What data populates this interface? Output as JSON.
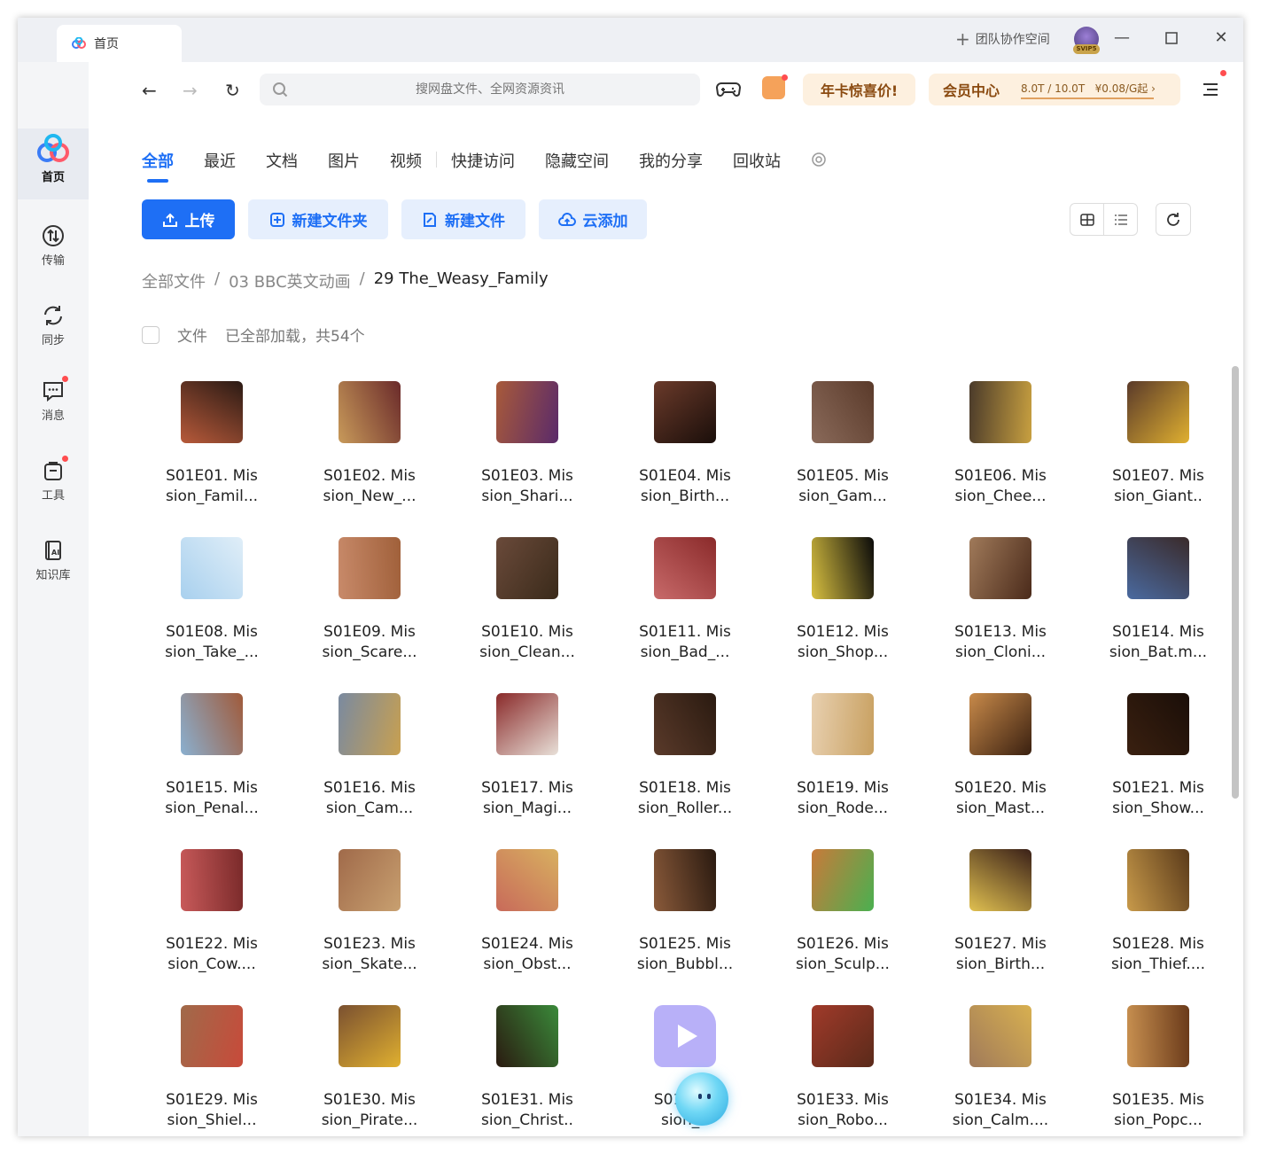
{
  "titlebar": {
    "tab_label": "首页",
    "team_label": "团队协作空间",
    "avatar_badge": "SVIP5"
  },
  "sidebar": {
    "items": [
      {
        "label": "首页",
        "icon": "baidu-netdisk-logo-icon"
      },
      {
        "label": "传输",
        "icon": "transfer-icon"
      },
      {
        "label": "同步",
        "icon": "sync-icon"
      },
      {
        "label": "消息",
        "icon": "message-icon"
      },
      {
        "label": "工具",
        "icon": "tools-icon"
      },
      {
        "label": "知识库",
        "icon": "knowledge-base-icon"
      }
    ]
  },
  "toolbar": {
    "search_placeholder": "搜网盘文件、全网资源资讯",
    "promo_label": "年卡惊喜价!",
    "vip_label": "会员中心",
    "storage_text": "8.0T / 10.0T",
    "price_text": "¥0.08/G起"
  },
  "categories": [
    "全部",
    "最近",
    "文档",
    "图片",
    "视频",
    "快捷访问",
    "隐藏空间",
    "我的分享",
    "回收站"
  ],
  "actions": {
    "upload": "上传",
    "new_folder": "新建文件夹",
    "new_file": "新建文件",
    "cloud_add": "云添加"
  },
  "breadcrumb": [
    "全部文件",
    "03 BBC英文动画",
    "29 The_Weasy_Family"
  ],
  "list_header": {
    "type_label": "文件",
    "status": "已全部加载，共54个"
  },
  "files": [
    {
      "line1": "S01E01. Mis",
      "line2": "sion_Famil...",
      "c1": "#b85a3a",
      "c2": "#2a1a14"
    },
    {
      "line1": "S01E02. Mis",
      "line2": "sion_New_...",
      "c1": "#c89a5a",
      "c2": "#6a2a2a"
    },
    {
      "line1": "S01E03. Mis",
      "line2": "sion_Shari...",
      "c1": "#a85a3a",
      "c2": "#5a2a6a"
    },
    {
      "line1": "S01E04. Mis",
      "line2": "sion_Birth...",
      "c1": "#6a3a2a",
      "c2": "#1a0e0a"
    },
    {
      "line1": "S01E05. Mis",
      "line2": "sion_Gam...",
      "c1": "#8a6a5a",
      "c2": "#5a3a2a"
    },
    {
      "line1": "S01E06. Mis",
      "line2": "sion_Chee...",
      "c1": "#4a3a2a",
      "c2": "#c8a040"
    },
    {
      "line1": "S01E07. Mis",
      "line2": "sion_Giant..",
      "c1": "#5a3a2a",
      "c2": "#e0b030"
    },
    {
      "line1": "S01E08. Mis",
      "line2": "sion_Take_...",
      "c1": "#a8d0ee",
      "c2": "#e0eef8"
    },
    {
      "line1": "S01E09. Mis",
      "line2": "sion_Scare...",
      "c1": "#c88a6a",
      "c2": "#a0603a"
    },
    {
      "line1": "S01E10. Mis",
      "line2": "sion_Clean...",
      "c1": "#6a4a3a",
      "c2": "#3a2a1a"
    },
    {
      "line1": "S01E11. Mis",
      "line2": "sion_Bad_...",
      "c1": "#c86a6a",
      "c2": "#8a2a2a"
    },
    {
      "line1": "S01E12. Mis",
      "line2": "sion_Shop...",
      "c1": "#d8c040",
      "c2": "#0a0a0a"
    },
    {
      "line1": "S01E13. Mis",
      "line2": "sion_Cloni...",
      "c1": "#a07a5a",
      "c2": "#4a2a1a"
    },
    {
      "line1": "S01E14. Mis",
      "line2": "sion_Bat.m...",
      "c1": "#4a6aa0",
      "c2": "#3a2a2a"
    },
    {
      "line1": "S01E15. Mis",
      "line2": "sion_Penal...",
      "c1": "#8ab0d0",
      "c2": "#a05a3a"
    },
    {
      "line1": "S01E16. Mis",
      "line2": "sion_Cam...",
      "c1": "#7a8aa0",
      "c2": "#c8a050"
    },
    {
      "line1": "S01E17. Mis",
      "line2": "sion_Magi...",
      "c1": "#8a2a2a",
      "c2": "#e8e0d8"
    },
    {
      "line1": "S01E18. Mis",
      "line2": "sion_Roller...",
      "c1": "#5a3a2a",
      "c2": "#2a1a10"
    },
    {
      "line1": "S01E19. Mis",
      "line2": "sion_Rode...",
      "c1": "#e8d0b0",
      "c2": "#c8a060"
    },
    {
      "line1": "S01E20. Mis",
      "line2": "sion_Mast...",
      "c1": "#c88a4a",
      "c2": "#3a2010"
    },
    {
      "line1": "S01E21. Mis",
      "line2": "sion_Show...",
      "c1": "#3a2010",
      "c2": "#1a0e08"
    },
    {
      "line1": "S01E22. Mis",
      "line2": "sion_Cow....",
      "c1": "#c85a5a",
      "c2": "#7a2a2a"
    },
    {
      "line1": "S01E23. Mis",
      "line2": "sion_Skate...",
      "c1": "#a06a4a",
      "c2": "#c8a070"
    },
    {
      "line1": "S01E24. Mis",
      "line2": "sion_Obst...",
      "c1": "#c86a5a",
      "c2": "#d8b060"
    },
    {
      "line1": "S01E25. Mis",
      "line2": "sion_Bubbl...",
      "c1": "#8a5a3a",
      "c2": "#2a1a10"
    },
    {
      "line1": "S01E26. Mis",
      "line2": "sion_Sculp...",
      "c1": "#c87a3a",
      "c2": "#4ab050"
    },
    {
      "line1": "S01E27. Mis",
      "line2": "sion_Birth...",
      "c1": "#e0c050",
      "c2": "#3a2018"
    },
    {
      "line1": "S01E28. Mis",
      "line2": "sion_Thief....",
      "c1": "#c89a4a",
      "c2": "#5a3a1a"
    },
    {
      "line1": "S01E29. Mis",
      "line2": "sion_Shiel...",
      "c1": "#a06a4a",
      "c2": "#c84a3a"
    },
    {
      "line1": "S01E30. Mis",
      "line2": "sion_Pirate...",
      "c1": "#7a5030",
      "c2": "#e0b030"
    },
    {
      "line1": "S01E31. Mis",
      "line2": "sion_Christ..",
      "c1": "#2a1a10",
      "c2": "#3a8a3a"
    },
    {
      "line1": "S01E32.",
      "line2": "sion_S",
      "c1": "#b8b0f8",
      "c2": "#9a8af0",
      "placeholder": true
    },
    {
      "line1": "S01E33. Mis",
      "line2": "sion_Robo...",
      "c1": "#a03a2a",
      "c2": "#5a2a1a"
    },
    {
      "line1": "S01E34. Mis",
      "line2": "sion_Calm....",
      "c1": "#a07a5a",
      "c2": "#d8b050"
    },
    {
      "line1": "S01E35. Mis",
      "line2": "sion_Popc...",
      "c1": "#c89050",
      "c2": "#6a3a1a"
    }
  ]
}
